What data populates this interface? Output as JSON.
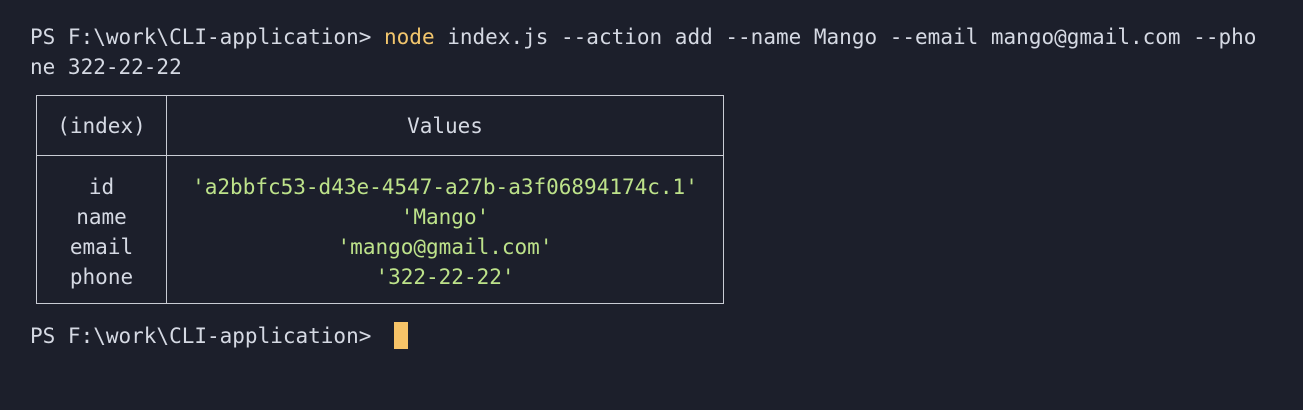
{
  "terminal": {
    "prompt": "PS F:\\work\\CLI-application> ",
    "command": {
      "program": "node",
      "args_line1": " index.js --action add --name Mango --email mango@gmail.com --pho",
      "args_line2": "ne 322-22-22"
    },
    "table": {
      "headers": [
        "(index)",
        "Values"
      ],
      "rows": [
        {
          "key": "id",
          "value": "'a2bbfc53-d43e-4547-a27b-a3f06894174c.1'"
        },
        {
          "key": "name",
          "value": "'Mango'"
        },
        {
          "key": "email",
          "value": "'mango@gmail.com'"
        },
        {
          "key": "phone",
          "value": "'322-22-22'"
        }
      ]
    },
    "prompt_after": "PS F:\\work\\CLI-application> "
  },
  "colors": {
    "background": "#1c1f2b",
    "text": "#d5d9e3",
    "command_highlight": "#f2c66d",
    "string_value": "#bde28a",
    "cursor": "#f6c368",
    "table_border": "#c9ccd4"
  }
}
